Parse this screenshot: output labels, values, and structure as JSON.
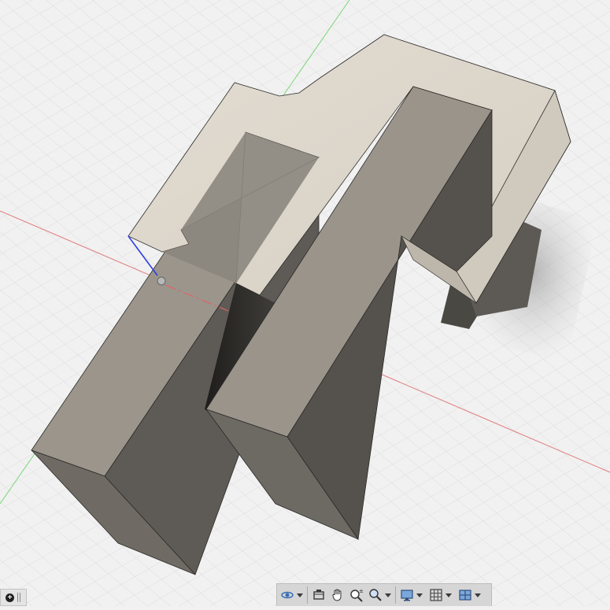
{
  "app": "3D CAD viewport",
  "viewport": {
    "background": "#f1f1f1",
    "grid_color": "#dadada",
    "axis_colors": {
      "x": "#e06464",
      "y": "#6ad46a",
      "z": "#3a3ad8"
    }
  },
  "model": {
    "top_face_color": "#ddd6cb",
    "side_face_light": "#8f8a82",
    "side_face_mid": "#6e6a63",
    "side_face_dark": "#4f4c47"
  },
  "navigation_toolbar": {
    "buttons": [
      {
        "name": "orbit",
        "icon": "orbit-icon",
        "has_menu": true
      },
      {
        "name": "look-at",
        "icon": "look-at-icon",
        "has_menu": false
      },
      {
        "name": "pan",
        "icon": "pan-hand-icon",
        "has_menu": false
      },
      {
        "name": "zoom",
        "icon": "zoom-icon",
        "has_menu": false
      },
      {
        "name": "fit",
        "icon": "fit-magnifier-icon",
        "has_menu": true
      },
      {
        "name": "display-settings",
        "icon": "monitor-icon",
        "has_menu": true
      },
      {
        "name": "grid-snaps",
        "icon": "grid-icon",
        "has_menu": true
      },
      {
        "name": "viewports",
        "icon": "viewports-icon",
        "has_menu": true
      }
    ]
  }
}
